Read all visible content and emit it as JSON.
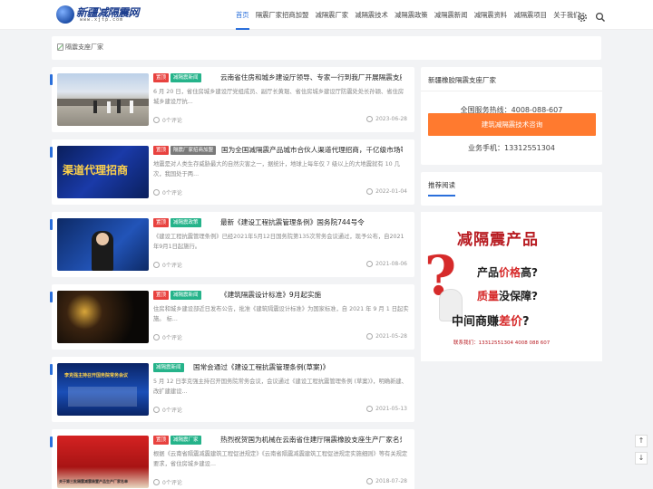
{
  "header": {
    "logo_text": "新疆减隔震网",
    "logo_domain": "www.xjtp.com",
    "nav": [
      "首页",
      "隔震厂家招商加盟",
      "减隔震厂家",
      "减隔震技术",
      "减隔震政策",
      "减隔震新闻",
      "减隔震资料",
      "减隔震项目",
      "关于我们"
    ],
    "active_nav": "首页"
  },
  "banner": {
    "alt_text": "隔震支座厂家"
  },
  "posts": [
    {
      "tags": [
        "置顶",
        "减隔震新闻"
      ],
      "title": "云南省住房和城乡建设厅领导、专家一行到我厂开展隔震支座质量检查",
      "excerpt": "6 月 20 日，省住房城乡建设厅党组成员、副厅长黄琨、省住房城乡建设厅防震处处长孙颖、省住房城乡建设厅抗...",
      "comments": "0个评论",
      "date": "2023-06-28",
      "thumb_text": ""
    },
    {
      "tags": [
        "置顶",
        "隔震厂家招商加盟"
      ],
      "title": "国为全国减隔震产品城市合伙人渠道代理招商，千亿级市场等您来",
      "excerpt": "地震是对人类生存威胁最大的自然灾害之一，据统计，地球上每年仅 7 级以上的大地震就有 10 几次，我国处于两...",
      "comments": "0个评论",
      "date": "2022-01-04",
      "thumb_text": "渠道代理招商"
    },
    {
      "tags": [
        "置顶",
        "减隔震政策"
      ],
      "title": "最新《建设工程抗震管理条例》国务院744号令",
      "excerpt": "《建设工程抗震管理条例》已经2021年5月12日国务院第135次常务会议通过，现予公布，自2021年9月1日起施行。",
      "comments": "0个评论",
      "date": "2021-08-06",
      "thumb_text": ""
    },
    {
      "tags": [
        "置顶",
        "减隔震新闻"
      ],
      "title": "《建筑隔震设计标准》9月起实施",
      "excerpt": "住房和城乡建设部近日发布公告，批准《建筑隔震设计标准》为国家标准，自 2021 年 9 月 1 日起实施。 标...",
      "comments": "0个评论",
      "date": "2021-05-28",
      "thumb_text": ""
    },
    {
      "tags": [
        "减隔震新闻"
      ],
      "title": "国常会通过《建设工程抗震管理条例(草案)》",
      "excerpt": "5 月 12 日李克强主持召开国务院常务会议，会议通过《建设工程抗震管理条例 (草案)》，明确新建、改扩建建设...",
      "comments": "0个评论",
      "date": "2021-05-13",
      "thumb_text": "李克强主持召开国务院常务会议"
    },
    {
      "tags": [
        "置顶",
        "减隔震厂家"
      ],
      "title": "热烈祝贺国为机械在云南省住建厅隔震橡胶支座生产厂家名录中",
      "excerpt": "根据《云南省隔震减震建筑工程促进规定》《云南省隔震减震建筑工程促进规定实施细则》等有关规定要求，省住房城乡建设...",
      "comments": "0个评论",
      "date": "2018-07-28",
      "thumb_text": "关于第三批隔震减震装置产品生产厂家名单"
    }
  ],
  "sidebar": {
    "contact_title": "新疆橡胶隔震支座厂家",
    "hotline": "全国服务热线：4008-088-607",
    "consult_button": "建筑减隔震技术咨询",
    "mobile": "业务手机：13312551304",
    "recommend_title": "推荐阅读"
  },
  "ad": {
    "line1": "减隔震产品",
    "line2_a": "产品",
    "line2_b": "价格",
    "line2_c": "高?",
    "line3_a": "质量",
    "line3_b": "没保障?",
    "line4_a": "中间商赚",
    "line4_b": "差价",
    "line4_c": "?",
    "contact": "联系我们：13312551304  4008 088 607"
  },
  "float_buttons": [
    "↑",
    "↓"
  ],
  "colors": {
    "accent": "#2a6fdb",
    "hot_tag": "#e8423f",
    "cat_tag": "#25b38a",
    "cta": "#ff7a2f"
  }
}
